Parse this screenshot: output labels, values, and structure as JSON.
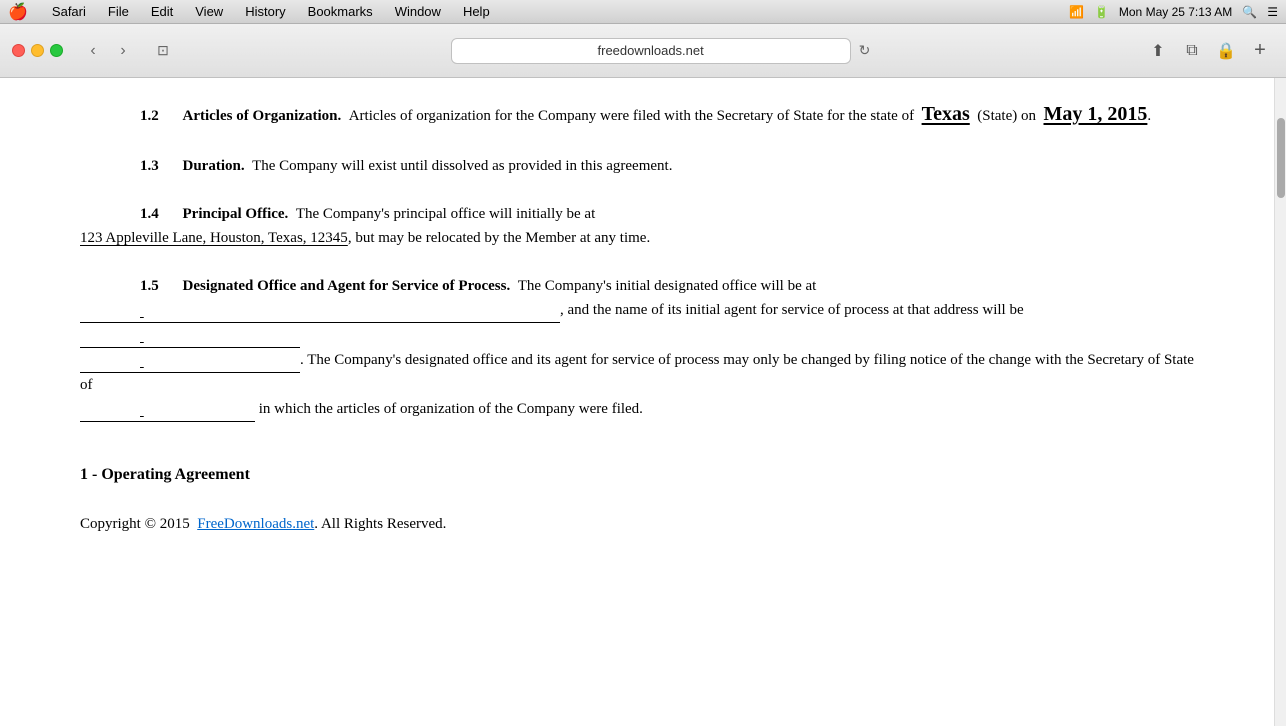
{
  "menubar": {
    "apple": "🍎",
    "items": [
      "Safari",
      "File",
      "Edit",
      "View",
      "History",
      "Bookmarks",
      "Window",
      "Help"
    ],
    "right": {
      "time": "Mon May 25  7:13 AM",
      "battery": "100%"
    }
  },
  "browser": {
    "url": "freedownloads.net",
    "nav": {
      "back": "‹",
      "forward": "›",
      "tab_view": "⊡",
      "refresh": "↻"
    }
  },
  "document": {
    "section_12": {
      "number": "1.2",
      "title": "Articles of Organization.",
      "text_before": "Articles of organization for the Company were filed with the Secretary of State for the state of",
      "state_value": "Texas",
      "text_middle": "(State) on",
      "date_value": "May 1, 2015",
      "text_after": "."
    },
    "section_13": {
      "number": "1.3",
      "title": "Duration.",
      "text": "The Company will exist until dissolved as provided in this agreement."
    },
    "section_14": {
      "number": "1.4",
      "title": "Principal Office.",
      "text_before": "The Company's principal office will initially be at",
      "address_value": "123 Appleville Lane, Houston, Texas, 12345",
      "text_after": ", but may be relocated by the Member at any time."
    },
    "section_15": {
      "number": "1.5",
      "title": "Designated Office and Agent for Service of Process.",
      "text1": "The Company's initial designated office will be at",
      "blank1": "",
      "text2": ", and the name of its initial agent for service of process at that address will be",
      "blank2": "",
      "blank3": "",
      "text3": ". The Company's designated office and its agent for service of process may only be changed by filing notice of the change with the Secretary of State of",
      "blank4": "",
      "text4": "in which the articles of organization of the Company were filed."
    },
    "footer_heading": "1 - Operating Agreement",
    "copyright": "Copyright © 2015",
    "copyright_link": "FreeDownloads.net",
    "copyright_end": ". All Rights Reserved."
  }
}
